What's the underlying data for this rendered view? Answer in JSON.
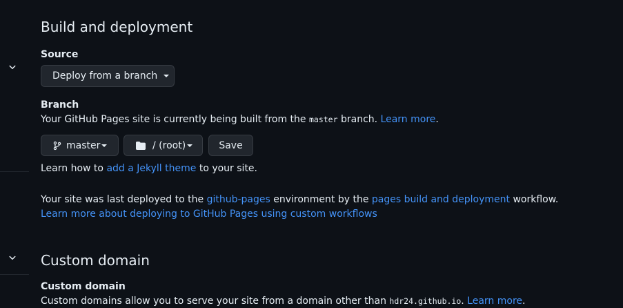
{
  "build": {
    "heading": "Build and deployment",
    "source_label": "Source",
    "source_dropdown": "Deploy from a branch",
    "branch_label": "Branch",
    "branch_desc_prefix": "Your GitHub Pages site is currently being built from the ",
    "branch_name_code": "master",
    "branch_desc_suffix": " branch. ",
    "learn_more": "Learn more",
    "period": ".",
    "branch_button": "master",
    "folder_button": "/ (root)",
    "save_button": "Save",
    "jekyll_prefix": "Learn how to ",
    "jekyll_link": "add a Jekyll theme",
    "jekyll_suffix": " to your site.",
    "deployed_prefix": "Your site was last deployed to the ",
    "deployed_env_link": "github-pages",
    "deployed_mid": " environment by the ",
    "deployed_workflow_link": "pages build and deployment",
    "deployed_suffix": " workflow.",
    "custom_workflows_link": "Learn more about deploying to GitHub Pages using custom workflows"
  },
  "custom_domain": {
    "heading": "Custom domain",
    "label": "Custom domain",
    "desc_prefix": "Custom domains allow you to serve your site from a domain other than ",
    "domain_code": "hdr24.github.io",
    "desc_suffix": ". ",
    "learn_more": "Learn more",
    "period": "."
  },
  "icons": {
    "sidebar_chevron_1": "chevron-down-icon",
    "sidebar_chevron_2": "chevron-down-icon",
    "branch": "git-branch-icon",
    "folder": "folder-icon",
    "caret": "triangle-down-icon"
  },
  "colors": {
    "background": "#0d1117",
    "text": "#e6edf3",
    "link": "#4493f8",
    "button_bg": "#21262d",
    "button_border": "#363b42"
  }
}
